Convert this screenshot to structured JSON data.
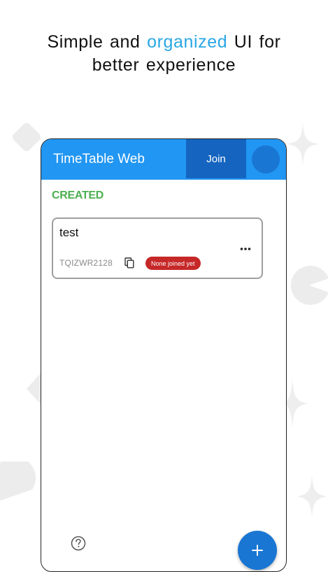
{
  "headline": {
    "line1_pre": "Simple and ",
    "line1_accent": "organized",
    "line1_post": " UI for",
    "line2": "better experience"
  },
  "app": {
    "title": "TimeTable Web",
    "join_label": "Join"
  },
  "section": {
    "label": "CREATED"
  },
  "card": {
    "title": "test",
    "code": "TQIZWR2128",
    "status": "None joined yet"
  },
  "colors": {
    "accent_text": "#2aa7e4",
    "appbar": "#2196f3",
    "join_button": "#1565c0",
    "section_label": "#4caf50",
    "status_badge": "#c62828",
    "fab": "#1976d2"
  },
  "icons": {
    "card_menu": "more-horizontal-icon",
    "copy": "copy-icon",
    "help": "help-circle-icon",
    "fab": "plus-icon"
  }
}
